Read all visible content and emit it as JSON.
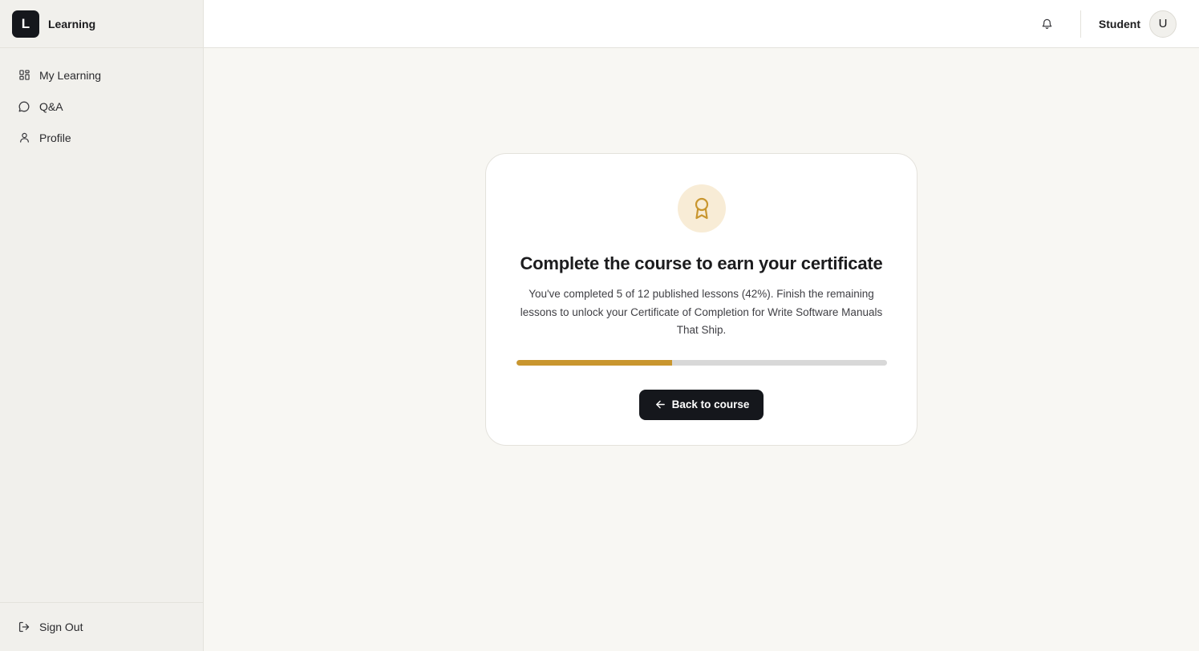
{
  "brand": {
    "logo_letter": "L",
    "name": "Learning"
  },
  "sidebar": {
    "items": [
      {
        "label": "My Learning",
        "icon": "grid-icon"
      },
      {
        "label": "Q&A",
        "icon": "chat-bubble-icon"
      },
      {
        "label": "Profile",
        "icon": "user-icon"
      }
    ],
    "footer": {
      "label": "Sign Out",
      "icon": "sign-out-icon"
    }
  },
  "header": {
    "notification_icon": "bell-icon",
    "user_name": "Student",
    "avatar_initial": "U"
  },
  "certificate_card": {
    "icon": "award-ribbon-icon",
    "title": "Complete the course to earn your certificate",
    "description": "You've completed 5 of 12 published lessons (42%). Finish the remaining lessons to unlock your Certificate of Completion for Write Software Manuals That Ship.",
    "progress_fraction": 0.42,
    "button_label": "Back to course",
    "button_icon": "arrow-left-icon"
  },
  "colors": {
    "accent": "#c9962f",
    "accent_soft": "#f8ecd6",
    "primary_dark": "#15171c",
    "page_bg": "#f8f7f3",
    "sidebar_bg": "#f1f0ec"
  }
}
